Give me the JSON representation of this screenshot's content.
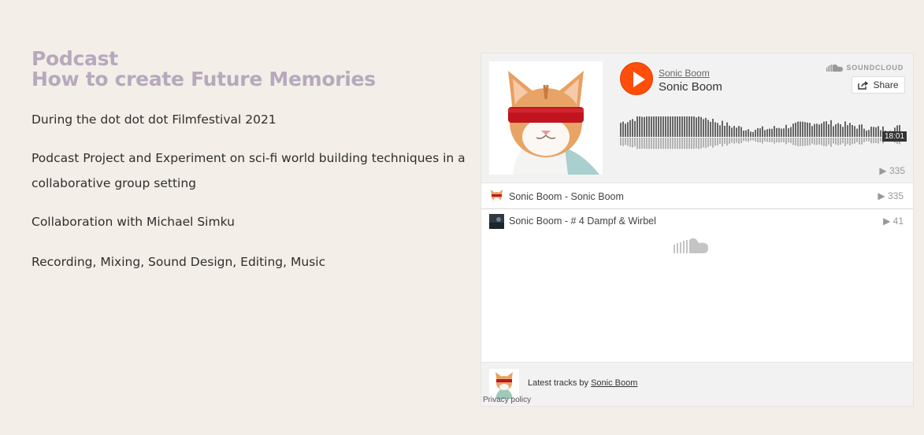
{
  "content": {
    "title_line1": "Podcast",
    "title_line2": "How to create Future Memories",
    "paragraph1": "During the dot dot dot Filmfestival 2021",
    "paragraph2": "Podcast Project and Experiment on sci-fi world building techniques in a collaborative group setting",
    "paragraph3": "Collaboration with Michael Simku",
    "paragraph4": "Recording, Mixing, Sound Design, Editing, Music"
  },
  "player": {
    "user": "Sonic Boom",
    "track_title": "Sonic Boom",
    "brand": "SOUNDCLOUD",
    "share_label": "Share",
    "duration": "18:01",
    "plays": "335",
    "accent_color": "#ff5500",
    "tracks": [
      {
        "title": "Sonic Boom - Sonic Boom",
        "plays": "335"
      },
      {
        "title": "Sonic Boom - # 4 Dampf & Wirbel",
        "plays": "41"
      }
    ],
    "footer": {
      "latest_prefix": "Latest tracks by ",
      "latest_user": "Sonic Boom",
      "privacy": "Privacy policy"
    }
  }
}
